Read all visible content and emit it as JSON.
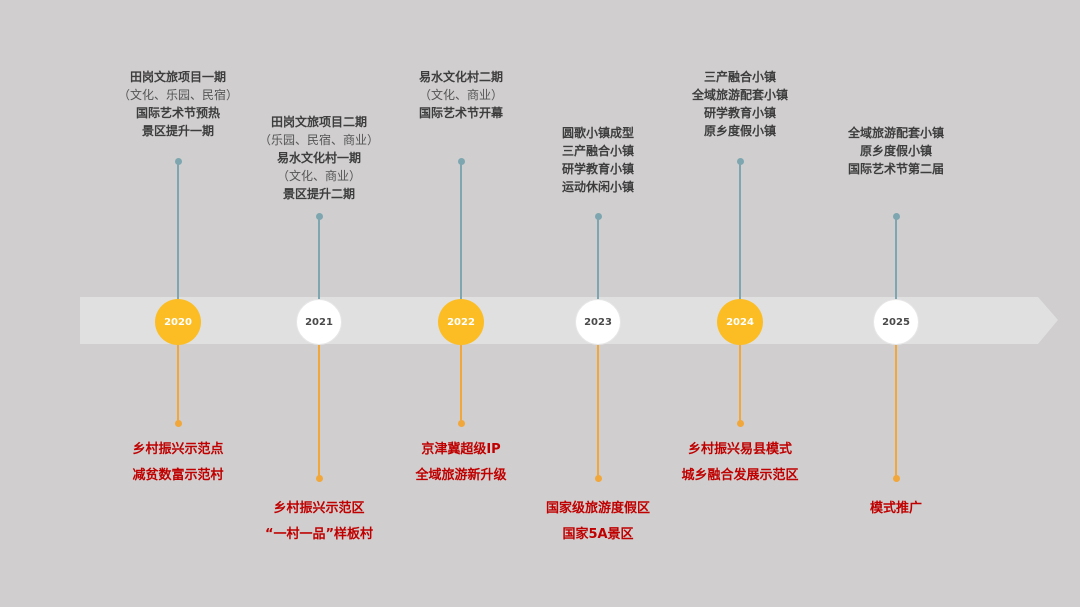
{
  "timeline": {
    "colors": {
      "background": "#d0cece",
      "arrow": "#e0e0e0",
      "highlight_node": "#fbbd23",
      "plain_node": "#ffffff",
      "upper_connector": "#7ea6b0",
      "lower_connector": "#f1a73a",
      "achievement_text": "#c00000"
    },
    "nodes": [
      {
        "year": "2020",
        "style": "gold",
        "upper": [
          {
            "text": "田岗文旅项目一期",
            "sub": false
          },
          {
            "text": "（文化、乐园、民宿）",
            "sub": true
          },
          {
            "text": "国际艺术节预热",
            "sub": false
          },
          {
            "text": "景区提升一期",
            "sub": false
          }
        ],
        "lower": [
          "乡村振兴示范点",
          "减贫数富示范村"
        ]
      },
      {
        "year": "2021",
        "style": "white",
        "upper": [
          {
            "text": "田岗文旅项目二期",
            "sub": false
          },
          {
            "text": "（乐园、民宿、商业）",
            "sub": true
          },
          {
            "text": "易水文化村一期",
            "sub": false
          },
          {
            "text": "（文化、商业）",
            "sub": true
          },
          {
            "text": "景区提升二期",
            "sub": false
          }
        ],
        "lower": [
          "乡村振兴示范区",
          "“一村一品”样板村"
        ]
      },
      {
        "year": "2022",
        "style": "gold",
        "upper": [
          {
            "text": "易水文化村二期",
            "sub": false
          },
          {
            "text": "（文化、商业）",
            "sub": true
          },
          {
            "text": "国际艺术节开幕",
            "sub": false
          }
        ],
        "lower": [
          "京津冀超级IP",
          "全域旅游新升级"
        ]
      },
      {
        "year": "2023",
        "style": "white",
        "upper": [
          {
            "text": "圆歌小镇成型",
            "sub": false
          },
          {
            "text": "三产融合小镇",
            "sub": false
          },
          {
            "text": "研学教育小镇",
            "sub": false
          },
          {
            "text": "运动休闲小镇",
            "sub": false
          }
        ],
        "lower": [
          "国家级旅游度假区",
          "国家5A景区"
        ]
      },
      {
        "year": "2024",
        "style": "gold",
        "upper": [
          {
            "text": "三产融合小镇",
            "sub": false
          },
          {
            "text": "全域旅游配套小镇",
            "sub": false
          },
          {
            "text": "研学教育小镇",
            "sub": false
          },
          {
            "text": "原乡度假小镇",
            "sub": false
          }
        ],
        "lower": [
          "乡村振兴易县模式",
          "城乡融合发展示范区"
        ]
      },
      {
        "year": "2025",
        "style": "white",
        "upper": [
          {
            "text": "全域旅游配套小镇",
            "sub": false
          },
          {
            "text": "原乡度假小镇",
            "sub": false
          },
          {
            "text": "国际艺术节第二届",
            "sub": false
          }
        ],
        "lower": [
          "模式推广"
        ]
      }
    ]
  }
}
